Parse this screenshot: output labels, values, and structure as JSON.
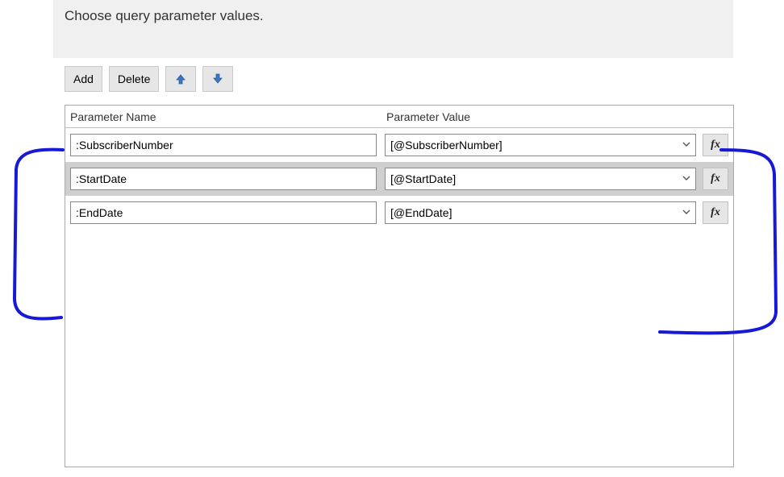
{
  "header": {
    "title": "Choose query parameter values."
  },
  "toolbar": {
    "add_label": "Add",
    "delete_label": "Delete"
  },
  "columns": {
    "name": "Parameter Name",
    "value": "Parameter Value"
  },
  "fx_label": "fx",
  "rows": [
    {
      "name": ":SubscriberNumber",
      "value": "[@SubscriberNumber]",
      "selected": false
    },
    {
      "name": ":StartDate",
      "value": "[@StartDate]",
      "selected": true
    },
    {
      "name": ":EndDate",
      "value": "[@EndDate]",
      "selected": false
    }
  ]
}
